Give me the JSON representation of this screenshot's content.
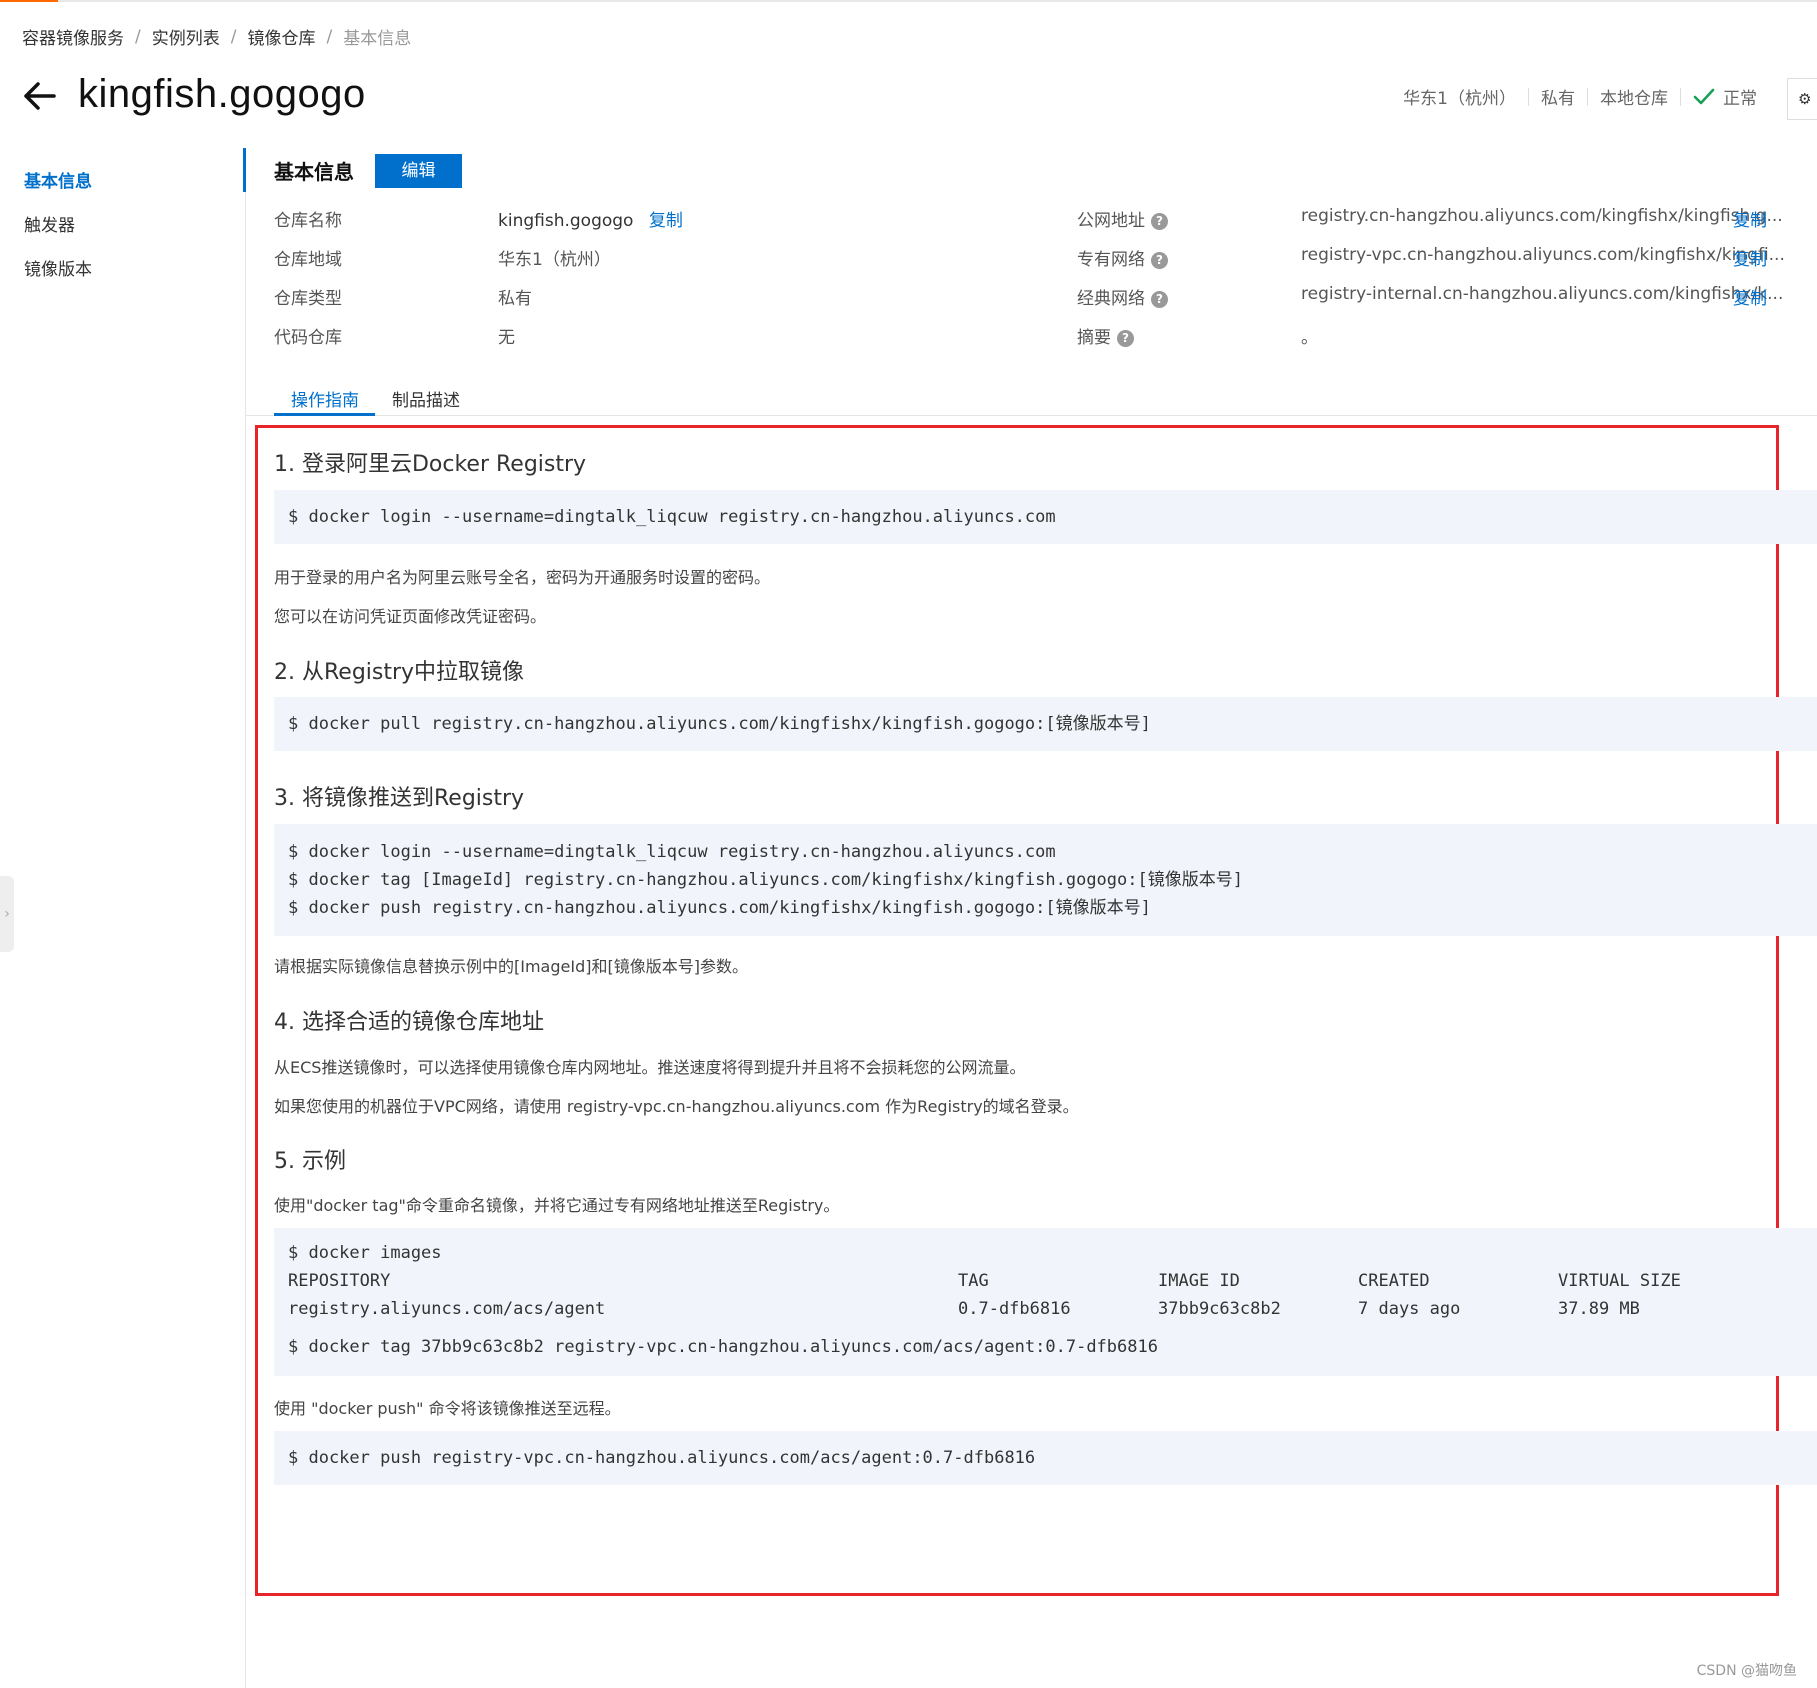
{
  "breadcrumb": [
    "容器镜像服务",
    "实例列表",
    "镜像仓库",
    "基本信息"
  ],
  "page": {
    "title": "kingfish.gogogo"
  },
  "status": {
    "region": "华东1（杭州）",
    "visibility": "私有",
    "repo_kind": "本地仓库",
    "state": "正常"
  },
  "sidebar": {
    "items": [
      {
        "label": "基本信息"
      },
      {
        "label": "触发器"
      },
      {
        "label": "镜像版本"
      }
    ]
  },
  "basic": {
    "title": "基本信息",
    "edit_label": "编辑",
    "copy_label": "复制",
    "left": [
      {
        "label": "仓库名称",
        "value": "kingfish.gogogo"
      },
      {
        "label": "仓库地域",
        "value": "华东1（杭州）"
      },
      {
        "label": "仓库类型",
        "value": "私有"
      },
      {
        "label": "代码仓库",
        "value": "无"
      }
    ],
    "right": [
      {
        "label": "公网地址",
        "value": "registry.cn-hangzhou.aliyuncs.com/kingfishx/kingfish.g..."
      },
      {
        "label": "专有网络",
        "value": "registry-vpc.cn-hangzhou.aliyuncs.com/kingfishx/kingfi..."
      },
      {
        "label": "经典网络",
        "value": "registry-internal.cn-hangzhou.aliyuncs.com/kingfishx/k..."
      },
      {
        "label": "摘要",
        "value": "。"
      }
    ]
  },
  "tabs": [
    {
      "label": "操作指南"
    },
    {
      "label": "制品描述"
    }
  ],
  "guide": {
    "s1": {
      "title": "1. 登录阿里云Docker Registry",
      "code": "$ docker login --username=dingtalk_liqcuw registry.cn-hangzhou.aliyuncs.com",
      "p1": "用于登录的用户名为阿里云账号全名，密码为开通服务时设置的密码。",
      "p2": "您可以在访问凭证页面修改凭证密码。"
    },
    "s2": {
      "title": "2. 从Registry中拉取镜像",
      "code": "$ docker pull registry.cn-hangzhou.aliyuncs.com/kingfishx/kingfish.gogogo:[镜像版本号]"
    },
    "s3": {
      "title": "3. 将镜像推送到Registry",
      "code": [
        "$ docker login --username=dingtalk_liqcuw registry.cn-hangzhou.aliyuncs.com",
        "$ docker tag [ImageId] registry.cn-hangzhou.aliyuncs.com/kingfishx/kingfish.gogogo:[镜像版本号]",
        "$ docker push registry.cn-hangzhou.aliyuncs.com/kingfishx/kingfish.gogogo:[镜像版本号]"
      ],
      "p1": "请根据实际镜像信息替换示例中的[ImageId]和[镜像版本号]参数。"
    },
    "s4": {
      "title": "4. 选择合适的镜像仓库地址",
      "p1": "从ECS推送镜像时，可以选择使用镜像仓库内网地址。推送速度将得到提升并且将不会损耗您的公网流量。",
      "p2": "如果您使用的机器位于VPC网络，请使用 registry-vpc.cn-hangzhou.aliyuncs.com 作为Registry的域名登录。"
    },
    "s5": {
      "title": "5. 示例",
      "p1": "使用\"docker tag\"命令重命名镜像，并将它通过专有网络地址推送至Registry。",
      "cmd1": "$ docker images",
      "table_header": [
        "REPOSITORY",
        "TAG",
        "IMAGE ID",
        "CREATED",
        "VIRTUAL SIZE"
      ],
      "table_row": [
        "registry.aliyuncs.com/acs/agent",
        "0.7-dfb6816",
        "37bb9c63c8b2",
        "7 days ago",
        "37.89 MB"
      ],
      "cmd2": "$ docker tag 37bb9c63c8b2 registry-vpc.cn-hangzhou.aliyuncs.com/acs/agent:0.7-dfb6816",
      "p2": "使用 \"docker push\" 命令将该镜像推送至远程。",
      "cmd3": "$ docker push registry-vpc.cn-hangzhou.aliyuncs.com/acs/agent:0.7-dfb6816"
    }
  },
  "watermark": "CSDN @猫吻鱼",
  "colors": {
    "accent": "#0070cc",
    "highlight_border": "#e8242b",
    "code_bg": "#f1f5fb",
    "ok": "#18a058"
  }
}
